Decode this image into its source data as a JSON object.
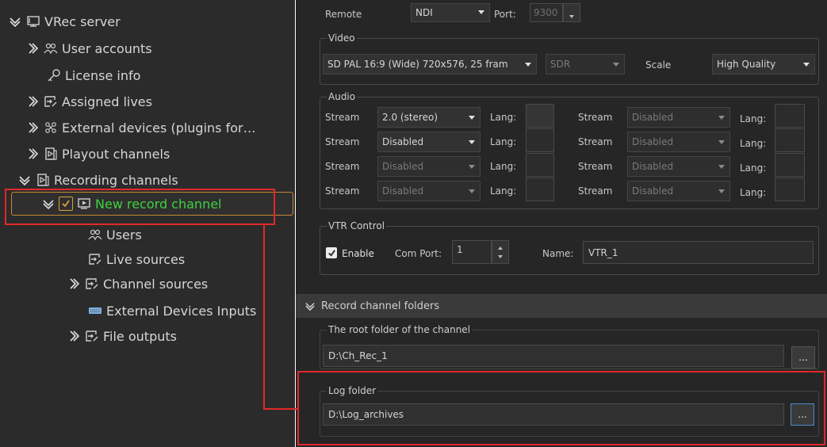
{
  "tree": {
    "root": "VRec server",
    "items": [
      {
        "label": "User accounts"
      },
      {
        "label": "License info"
      },
      {
        "label": "Assigned lives"
      },
      {
        "label": "External devices (plugins for…"
      },
      {
        "label": "Playout channels"
      },
      {
        "label": "Recording channels"
      }
    ],
    "selected": {
      "label": "New record channel",
      "checked": true,
      "color": "#3fd13f"
    },
    "children": [
      {
        "label": "Users"
      },
      {
        "label": "Live sources"
      },
      {
        "label": "Channel sources"
      },
      {
        "label": "External Devices Inputs"
      },
      {
        "label": "File outputs"
      }
    ]
  },
  "remote": {
    "label": "Remote",
    "value": "NDI",
    "port_label": "Port:",
    "port_value": "9300"
  },
  "video": {
    "title": "Video",
    "format": "SD PAL 16:9 (Wide) 720x576, 25 fram",
    "range": "SDR",
    "scale_label": "Scale",
    "scale_value": "High Quality"
  },
  "audio": {
    "title": "Audio",
    "stream_label": "Stream",
    "lang_label": "Lang:",
    "left": [
      "2.0 (stereo)",
      "Disabled",
      "Disabled",
      "Disabled"
    ],
    "right": [
      "Disabled",
      "Disabled",
      "Disabled",
      "Disabled"
    ]
  },
  "vtr": {
    "title": "VTR Control",
    "enable_label": "Enable",
    "enabled": true,
    "comport_label": "Com Port:",
    "comport_value": "1",
    "name_label": "Name:",
    "name_value": "VTR_1"
  },
  "folders": {
    "section_title": "Record channel folders",
    "root_title": "The root folder of the channel",
    "root_value": "D:\\Ch_Rec_1",
    "log_title": "Log folder",
    "log_value": "D:\\Log_archives",
    "browse_label": "..."
  },
  "colors": {
    "highlight": "#e2282a",
    "selected_text": "#3fd13f",
    "selection_border": "#c88a2e"
  }
}
